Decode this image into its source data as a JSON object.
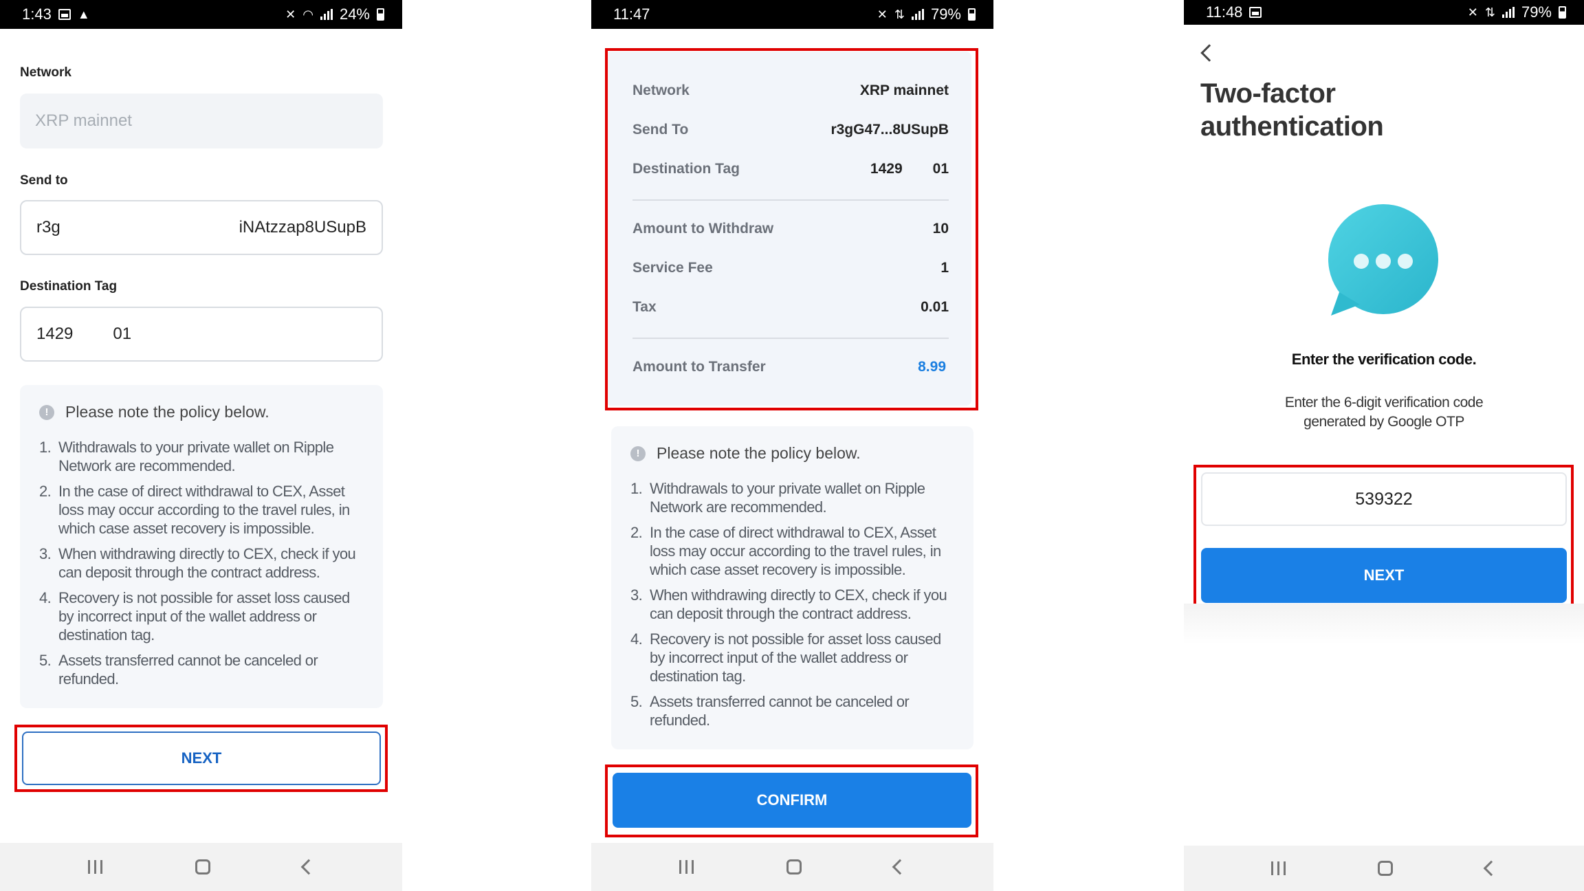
{
  "screens": [
    {
      "status": {
        "time": "1:43",
        "battery": "24%"
      },
      "form": {
        "network_label": "Network",
        "network_value": "XRP mainnet",
        "send_to_label": "Send to",
        "send_to_start": "r3g",
        "send_to_end": "iNAtzzap8USupB",
        "dest_tag_label": "Destination Tag",
        "dest_tag_a": "1429",
        "dest_tag_b": "01"
      },
      "next_label": "NEXT"
    },
    {
      "status": {
        "time": "11:47",
        "battery": "79%"
      },
      "summary": {
        "network_label": "Network",
        "network_value": "XRP mainnet",
        "send_to_label": "Send To",
        "send_to_value": "r3gG47...8USupB",
        "dest_tag_label": "Destination Tag",
        "dest_tag_a": "1429",
        "dest_tag_b": "01",
        "amount_label": "Amount to Withdraw",
        "amount_value": "10",
        "fee_label": "Service Fee",
        "fee_value": "1",
        "tax_label": "Tax",
        "tax_value": "0.01",
        "transfer_label": "Amount to Transfer",
        "transfer_value": "8.99"
      },
      "confirm_label": "CONFIRM"
    },
    {
      "status": {
        "time": "11:48",
        "battery": "79%"
      },
      "title_line1": "Two-factor",
      "title_line2": "authentication",
      "prompt": "Enter the verification code.",
      "desc_line1": "Enter the 6-digit verification code",
      "desc_line2": "generated by Google OTP",
      "otp_value": "539322",
      "next_label": "NEXT"
    }
  ],
  "policy": {
    "heading": "Please note the policy below.",
    "items": [
      {
        "num": "1.",
        "text": "Withdrawals to your private wallet on Ripple Network are recommended."
      },
      {
        "num": "2.",
        "text": "In the case of direct withdrawal to CEX, Asset loss may occur according to the travel rules, in which case asset recovery is impossible."
      },
      {
        "num": "3.",
        "text": "When withdrawing directly to CEX, check if you can deposit through the contract address."
      },
      {
        "num": "4.",
        "text": "Recovery is not possible for asset loss caused by incorrect input of the wallet address or destination tag."
      },
      {
        "num": "5.",
        "text": "Assets transferred cannot be canceled or refunded."
      }
    ]
  },
  "colors": {
    "primary": "#1a80e6",
    "highlight": "#e00000",
    "accent_text": "#1a7ee0",
    "chat_icon": "#35c7d8"
  }
}
